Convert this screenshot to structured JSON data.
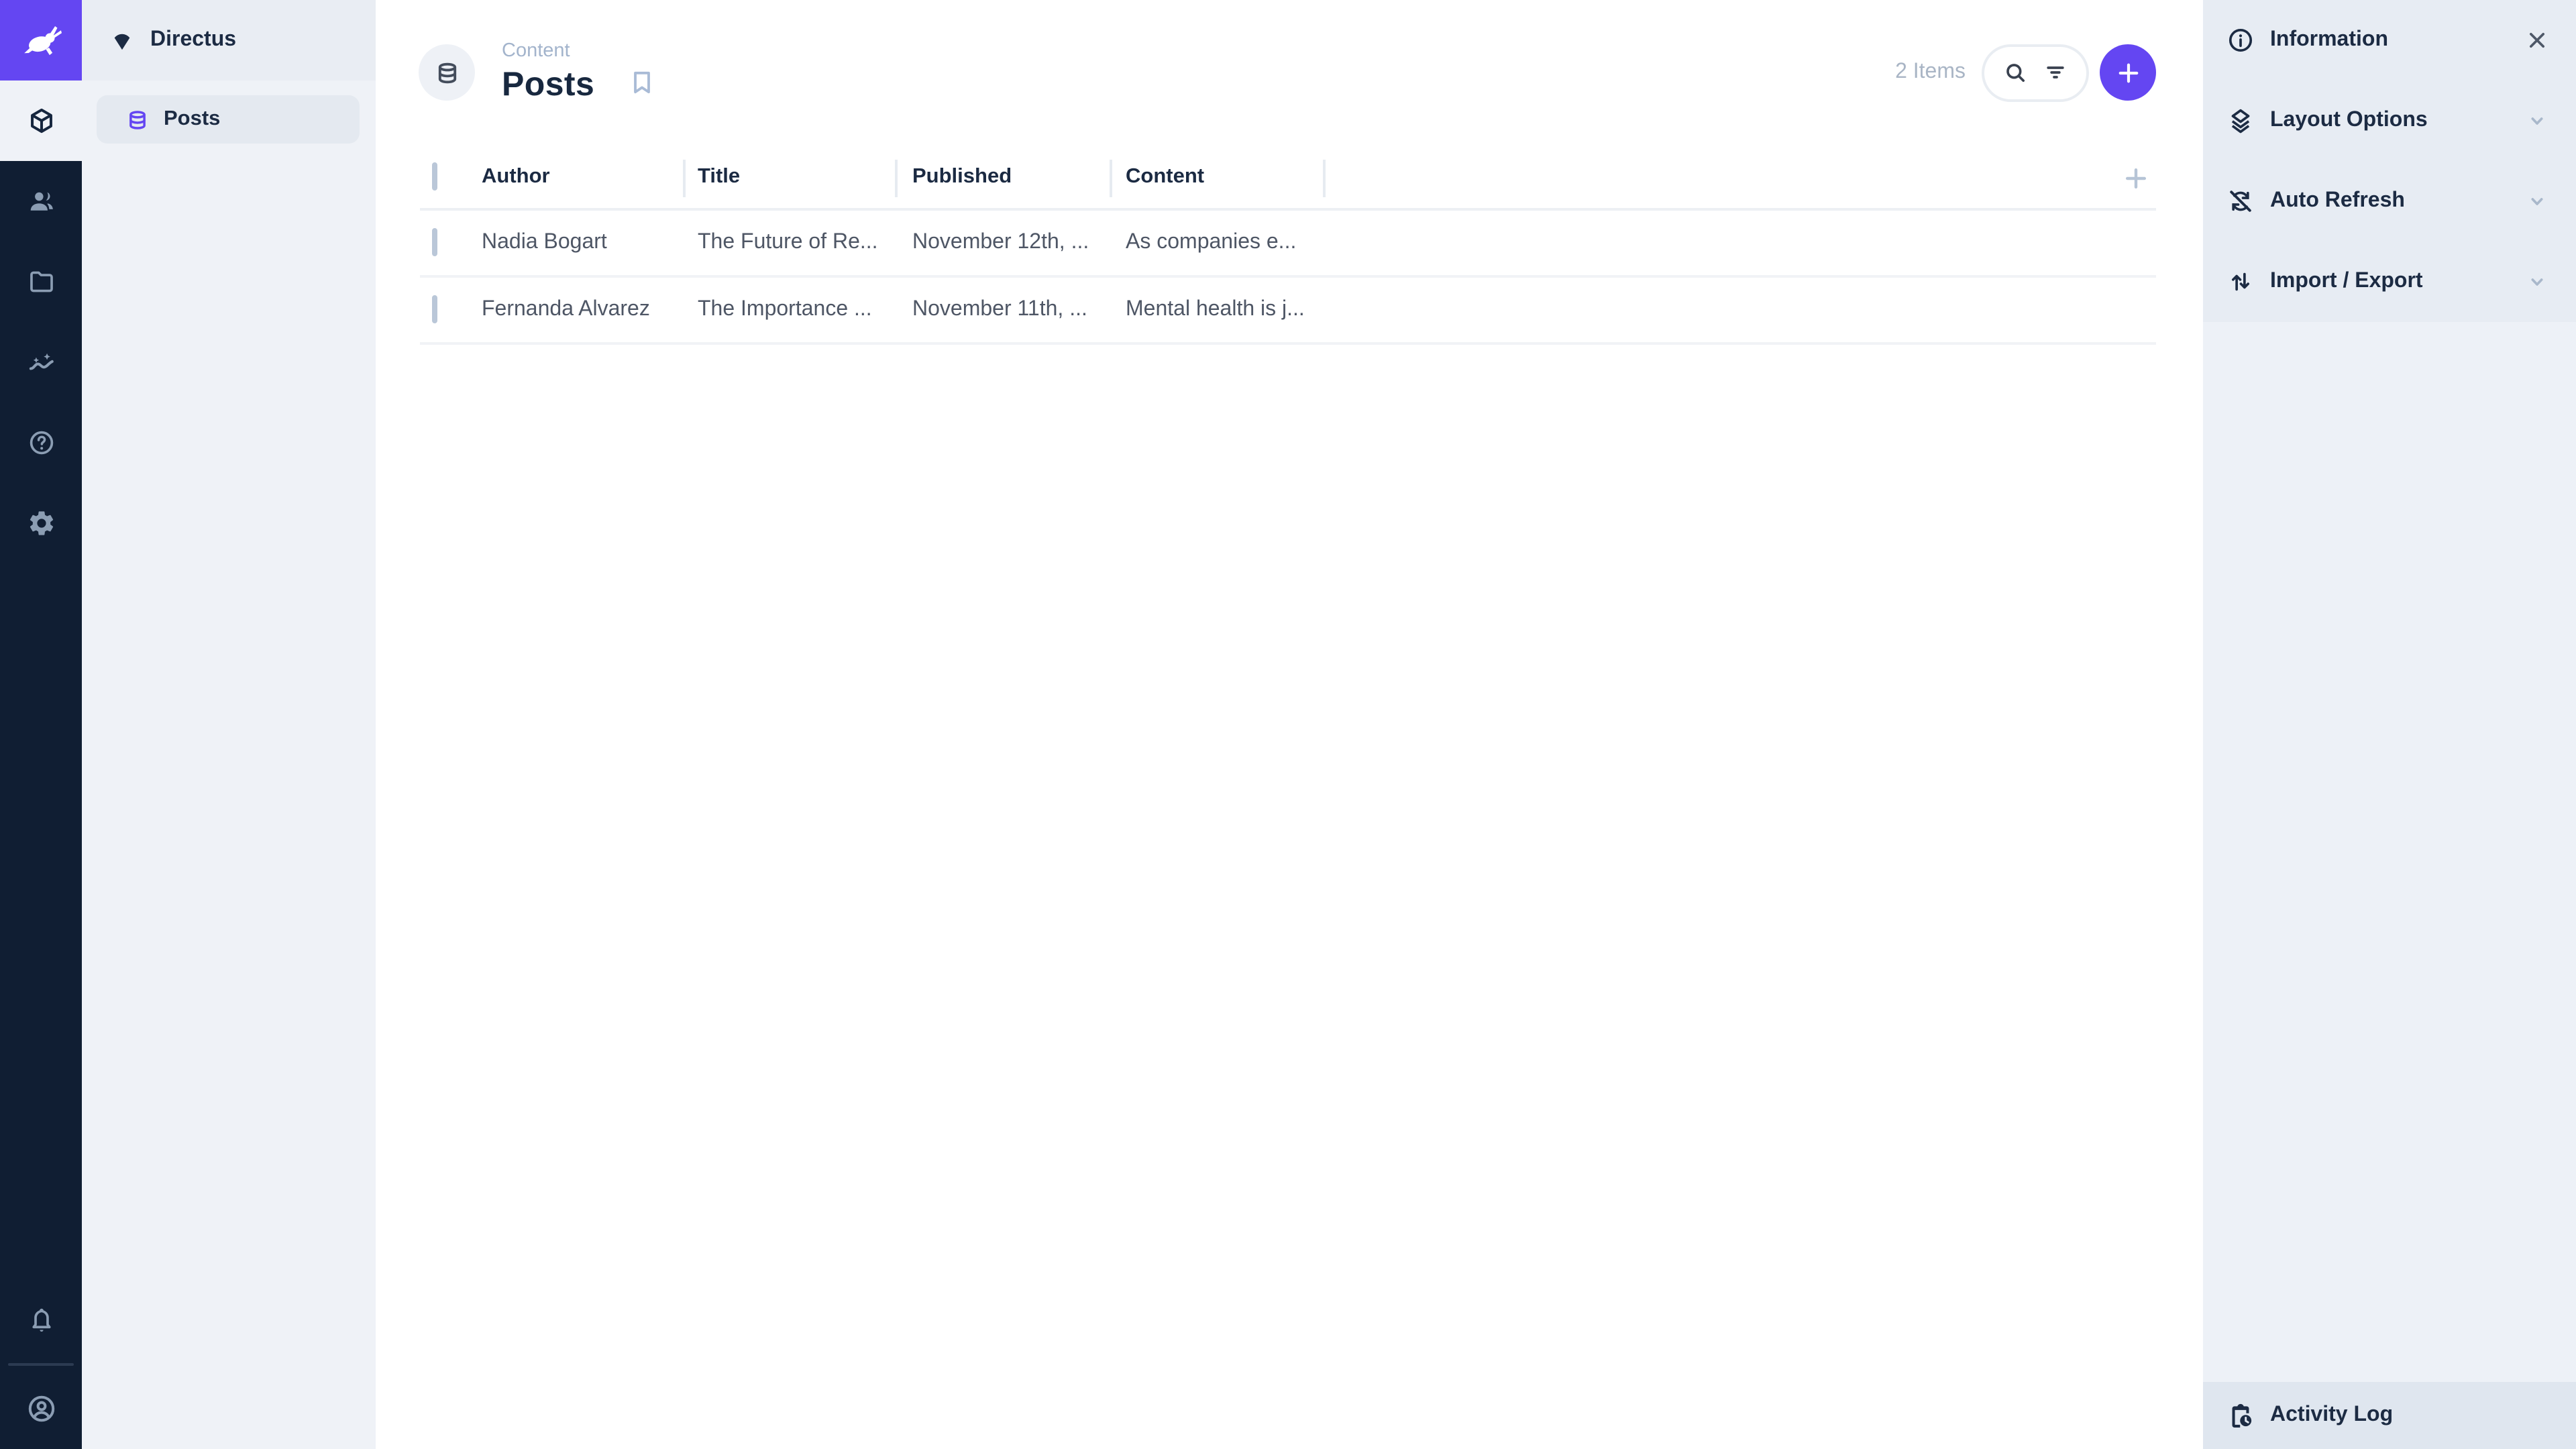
{
  "colors": {
    "brand_purple": "#6446f2",
    "module_bar_bg": "#101e33",
    "module_icon": "#8b9db3",
    "sidebar_bg": "#eff2f7",
    "right_sidebar_bg": "#edf1f7",
    "section_row_bg": "#e7ecf3",
    "activity_bar_bg": "#dfe6ef",
    "title_text": "#18283f",
    "muted_text": "#a9b5c5",
    "cell_text": "#4e5665"
  },
  "module_bar": {
    "logo_icon": "directus-rabbit-logo",
    "modules": [
      {
        "name": "content",
        "icon": "cube-icon",
        "active": true
      },
      {
        "name": "user-directory",
        "icon": "people-icon",
        "active": false
      },
      {
        "name": "file-library",
        "icon": "folder-icon",
        "active": false
      },
      {
        "name": "insights",
        "icon": "insights-icon",
        "active": false
      },
      {
        "name": "documentation",
        "icon": "help-icon",
        "active": false
      },
      {
        "name": "settings",
        "icon": "gear-icon",
        "active": false
      }
    ],
    "bottom": [
      {
        "name": "notifications",
        "icon": "bell-icon"
      },
      {
        "name": "account",
        "icon": "account-circle-icon"
      }
    ]
  },
  "nav": {
    "project_name": "Directus",
    "project_icon": "fan-wedge-icon",
    "items": [
      {
        "label": "Posts",
        "icon": "database-icon",
        "active": true
      }
    ]
  },
  "header": {
    "collection_icon": "database-icon",
    "module_label": "Content",
    "title": "Posts",
    "bookmark_icon": "bookmark-icon",
    "items_count": "2 Items",
    "search_icon": "search-icon",
    "filter_icon": "filter-icon",
    "add_icon": "plus-icon"
  },
  "table": {
    "columns": [
      "Author",
      "Title",
      "Published",
      "Content"
    ],
    "rows": [
      [
        "Nadia Bogart",
        "The Future of Re...",
        "November 12th, ...",
        "As companies e..."
      ],
      [
        "Fernanda Alvarez",
        "The Importance ...",
        "November 11th, ...",
        "Mental health is j..."
      ]
    ]
  },
  "sidebar_right": {
    "sections": [
      {
        "label": "Information",
        "icon": "info-icon",
        "control": "close-icon"
      },
      {
        "label": "Layout Options",
        "icon": "layers-icon",
        "control": "chevron-down-icon"
      },
      {
        "label": "Auto Refresh",
        "icon": "sync-disabled-icon",
        "control": "chevron-down-icon"
      },
      {
        "label": "Import / Export",
        "icon": "import-export-icon",
        "control": "chevron-down-icon"
      }
    ],
    "activity_log_label": "Activity Log",
    "activity_log_icon": "activity-log-icon"
  }
}
